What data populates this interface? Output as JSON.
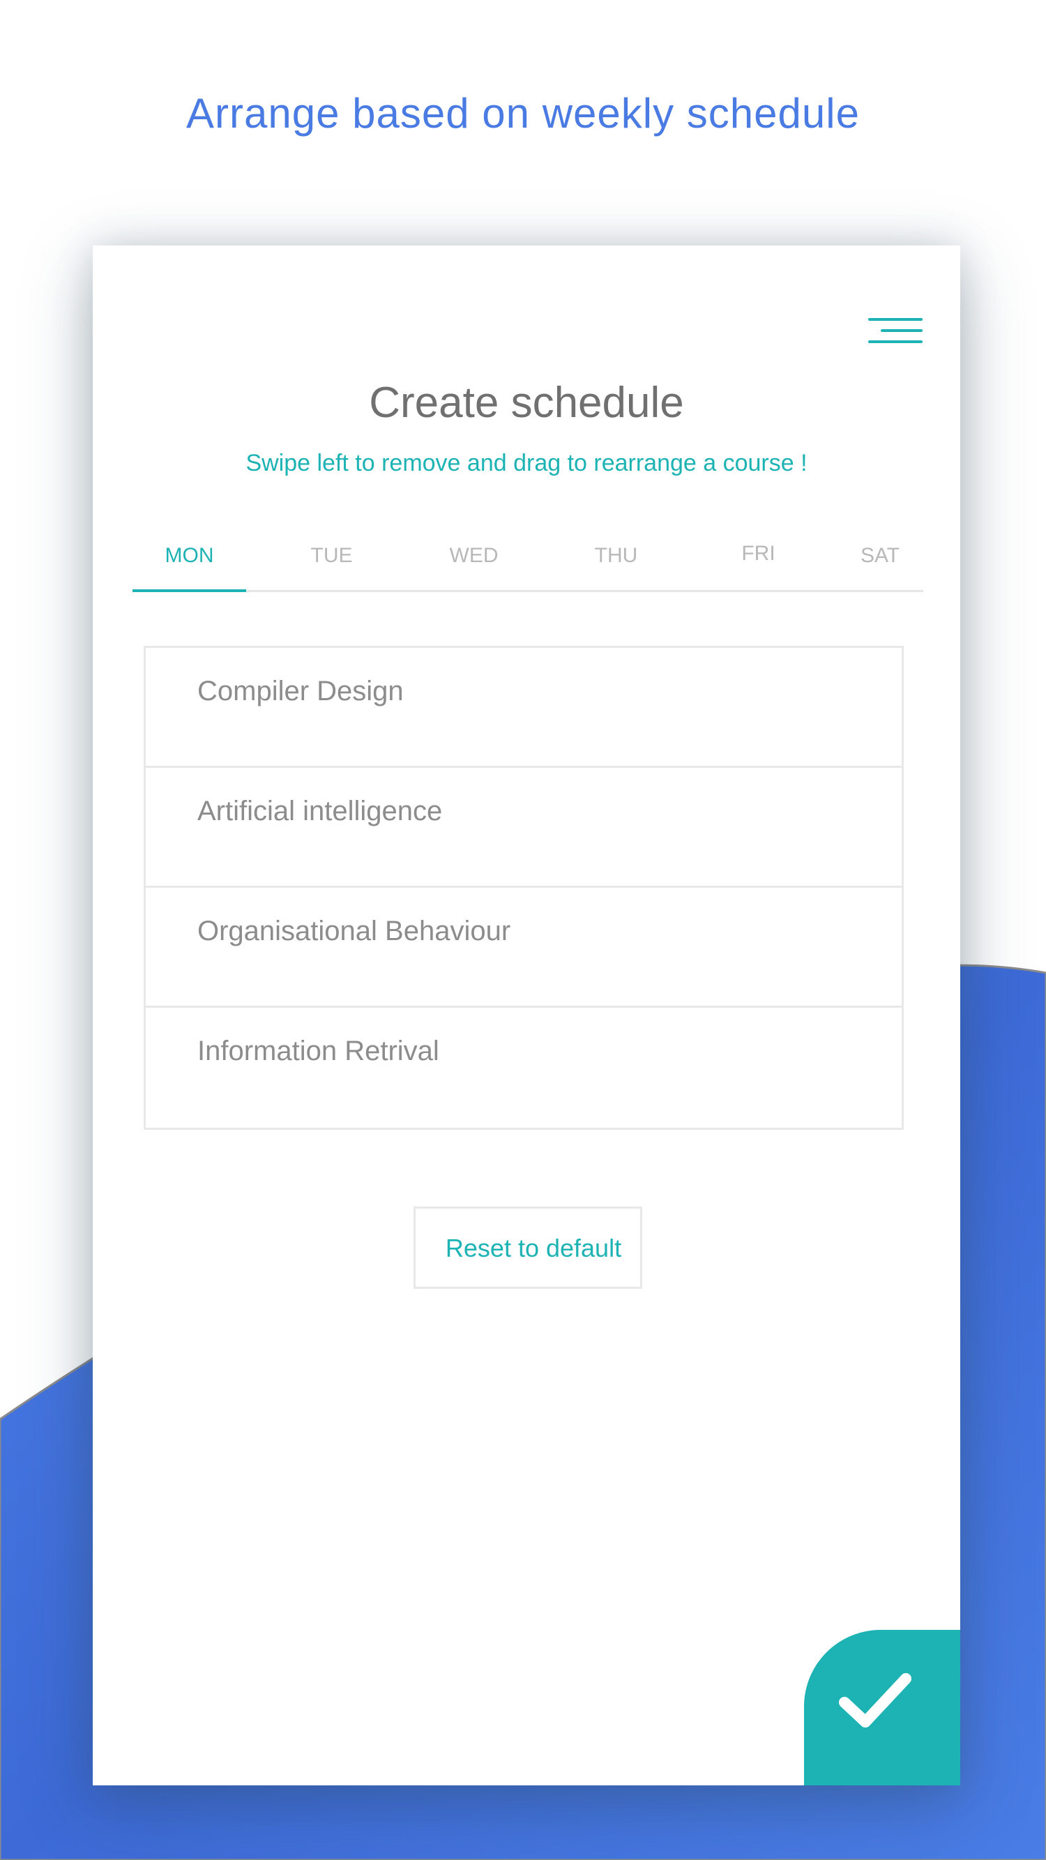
{
  "headline": "Arrange based on weekly schedule",
  "card": {
    "title": "Create schedule",
    "subtitle": "Swipe left to remove and drag to rearrange a course !"
  },
  "tabs": [
    {
      "label": "MON",
      "active": true
    },
    {
      "label": "TUE",
      "active": false
    },
    {
      "label": "WED",
      "active": false
    },
    {
      "label": "THU",
      "active": false
    },
    {
      "label": "FRI",
      "active": false
    },
    {
      "label": "SAT",
      "active": false
    }
  ],
  "courses": [
    {
      "name": "Compiler Design"
    },
    {
      "name": "Artificial intelligence"
    },
    {
      "name": "Organisational Behaviour"
    },
    {
      "name": "Information Retrival"
    }
  ],
  "reset_label": "Reset to default",
  "icons": {
    "menu": "hamburger-menu-icon",
    "confirm": "checkmark-icon"
  },
  "colors": {
    "accent": "#1db3b4",
    "headline": "#4a7be3",
    "background_wave": "#4a7be3"
  }
}
